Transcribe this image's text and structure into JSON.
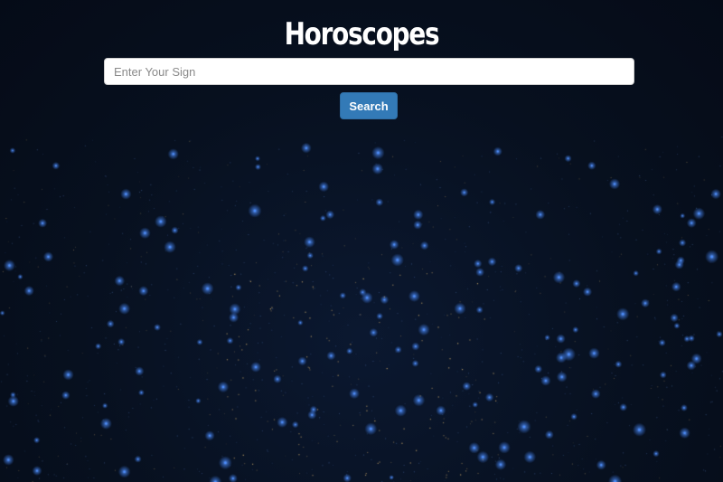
{
  "header": {
    "title": "Horoscopes"
  },
  "search": {
    "placeholder": "Enter Your Sign",
    "value": "",
    "button_label": "Search"
  },
  "colors": {
    "background": "#07101f",
    "title": "#ffffff",
    "button": "#337ab7",
    "button_border": "#2e6da4",
    "star_blue": "#4a8cff",
    "star_warm": "#c9a76a"
  }
}
